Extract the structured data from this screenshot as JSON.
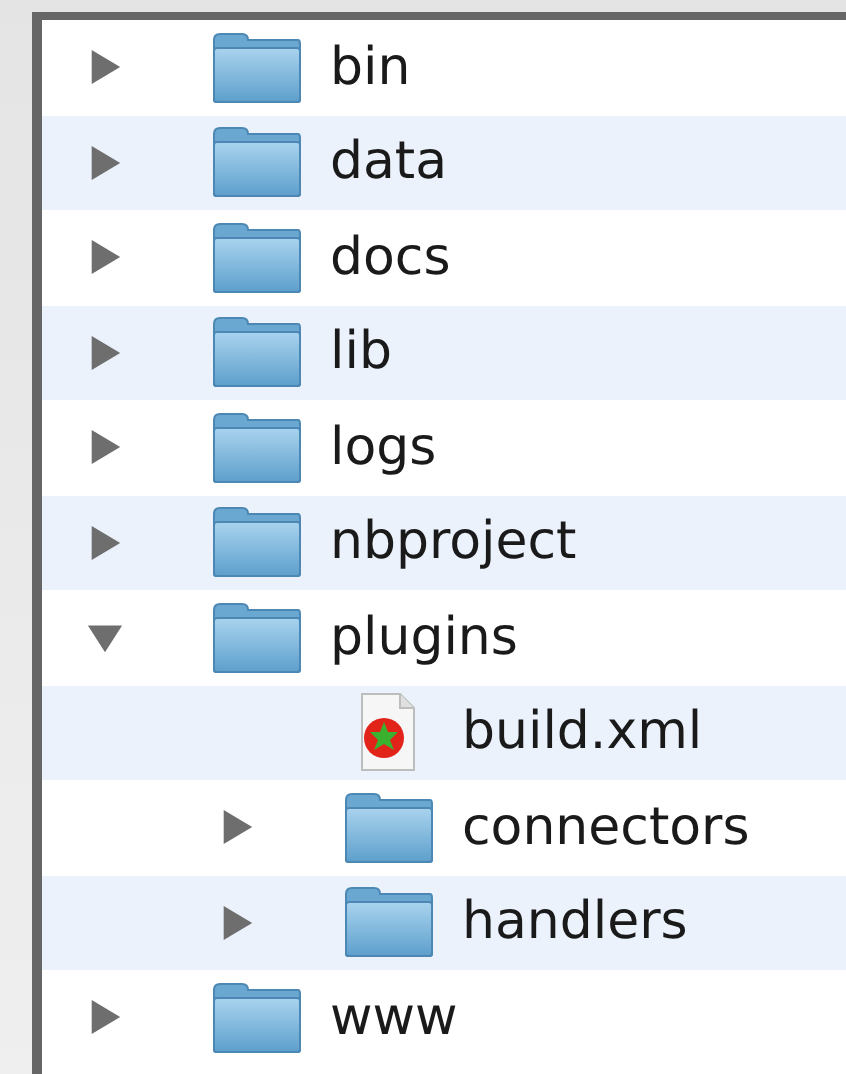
{
  "tree": [
    {
      "name": "bin",
      "kind": "folder",
      "expanded": false
    },
    {
      "name": "data",
      "kind": "folder",
      "expanded": false
    },
    {
      "name": "docs",
      "kind": "folder",
      "expanded": false
    },
    {
      "name": "lib",
      "kind": "folder",
      "expanded": false
    },
    {
      "name": "logs",
      "kind": "folder",
      "expanded": false
    },
    {
      "name": "nbproject",
      "kind": "folder",
      "expanded": false
    },
    {
      "name": "plugins",
      "kind": "folder",
      "expanded": true,
      "children": [
        {
          "name": "build.xml",
          "kind": "file"
        },
        {
          "name": "connectors",
          "kind": "folder",
          "expanded": false
        },
        {
          "name": "handlers",
          "kind": "folder",
          "expanded": false
        }
      ]
    },
    {
      "name": "www",
      "kind": "folder",
      "expanded": false
    }
  ]
}
